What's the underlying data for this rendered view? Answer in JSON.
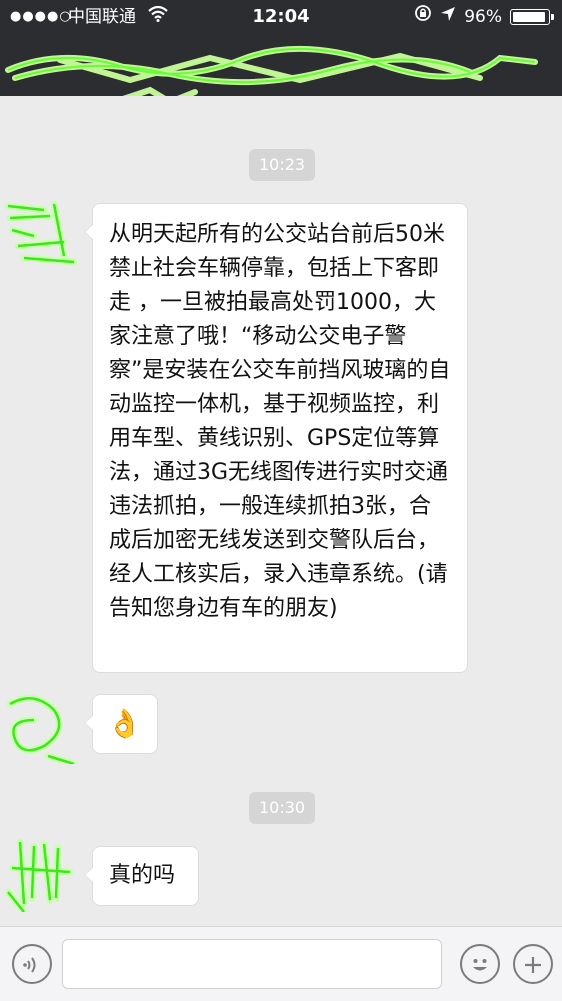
{
  "status_bar": {
    "signal": "●●●●○",
    "carrier": "中国联通",
    "time": "12:04",
    "battery_percent_label": "96%",
    "battery_level": 0.96
  },
  "header": {
    "title_obscured": true
  },
  "messages": [
    {
      "type": "timestamp",
      "text": "10:23"
    },
    {
      "type": "incoming",
      "text": "从明天起所有的公交站台前后50米禁止社会车辆停靠，包括上下客即走 ，一旦被拍最高处罚1000，大家注意了哦！“移动公交电子警察”是安装在公交车前挡风玻璃的自动监控一体机，基于视频监控，利用车型、黄线识别、GPS定位等算法，通过3G无线图传进行实时交通违法抓拍，一般连续抓拍3张，合成后加密无线发送到交警队后台，经人工核实后，录入违章系统。(请告知您身边有车的朋友)"
    },
    {
      "type": "incoming",
      "emoji": "👌"
    },
    {
      "type": "timestamp",
      "text": "10:30"
    },
    {
      "type": "incoming",
      "text": "真的吗"
    }
  ],
  "input_bar": {
    "voice_icon": "voice-icon",
    "emoji_icon": "smiley-icon",
    "more_icon": "plus-icon"
  },
  "colors": {
    "nav_bg": "#2b2d31",
    "chat_bg": "#ebebeb",
    "scribble": "#7dff5a"
  }
}
